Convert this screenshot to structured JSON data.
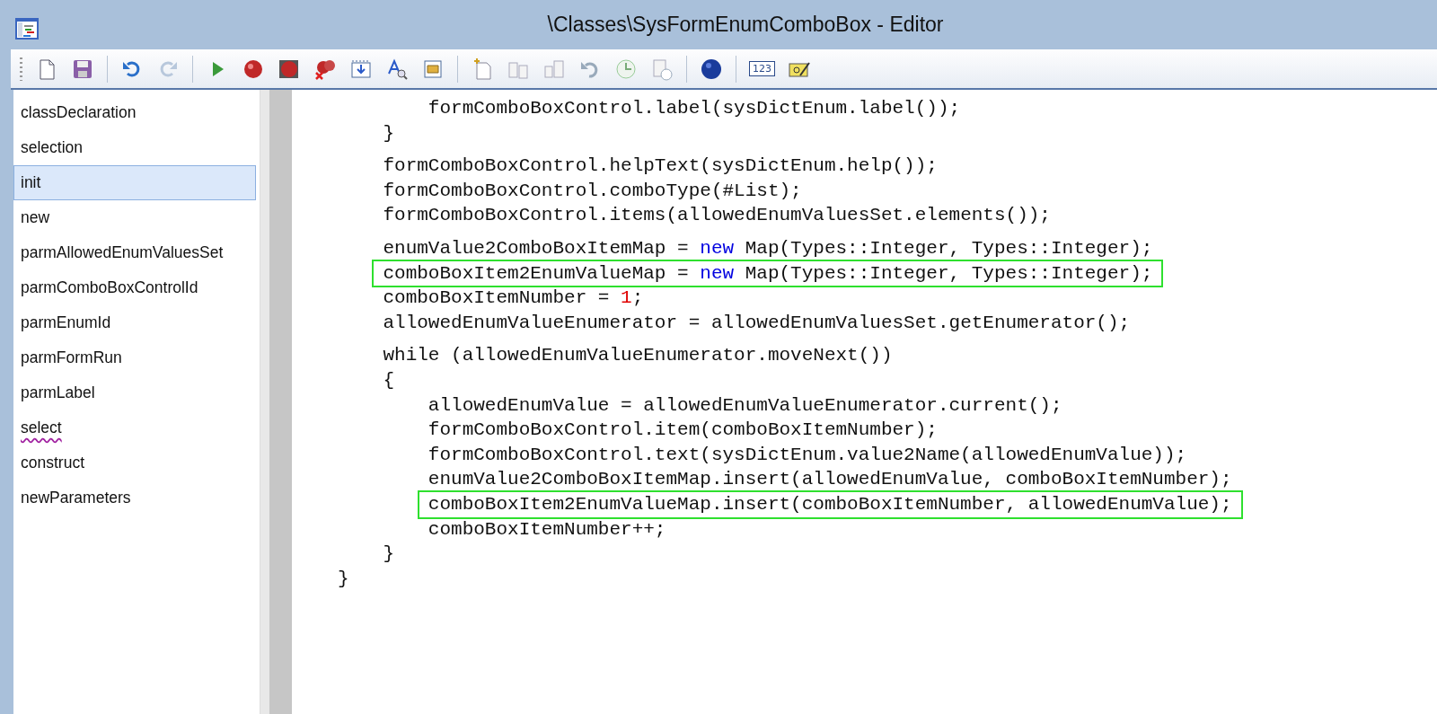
{
  "window": {
    "title": "\\Classes\\SysFormEnumComboBox - Editor"
  },
  "methods": [
    {
      "label": "classDeclaration",
      "selected": false,
      "flagged": false
    },
    {
      "label": "selection",
      "selected": false,
      "flagged": false
    },
    {
      "label": "init",
      "selected": true,
      "flagged": false
    },
    {
      "label": "new",
      "selected": false,
      "flagged": false
    },
    {
      "label": "parmAllowedEnumValuesSet",
      "selected": false,
      "flagged": false
    },
    {
      "label": "parmComboBoxControlId",
      "selected": false,
      "flagged": false
    },
    {
      "label": "parmEnumId",
      "selected": false,
      "flagged": false
    },
    {
      "label": "parmFormRun",
      "selected": false,
      "flagged": false
    },
    {
      "label": "parmLabel",
      "selected": false,
      "flagged": false
    },
    {
      "label": "select",
      "selected": false,
      "flagged": true
    },
    {
      "label": "construct",
      "selected": false,
      "flagged": false
    },
    {
      "label": "newParameters",
      "selected": false,
      "flagged": false
    }
  ],
  "code_blocks": [
    {
      "lines": [
        {
          "boxed": false,
          "segments": [
            {
              "kind": "plain",
              "text": "        formComboBoxControl.label(sysDictEnum.label());"
            }
          ]
        },
        {
          "boxed": false,
          "segments": [
            {
              "kind": "plain",
              "text": "    }"
            }
          ]
        }
      ]
    },
    {
      "lines": [
        {
          "boxed": false,
          "segments": [
            {
              "kind": "plain",
              "text": "    formComboBoxControl.helpText(sysDictEnum.help());"
            }
          ]
        },
        {
          "boxed": false,
          "segments": [
            {
              "kind": "plain",
              "text": "    formComboBoxControl.comboType(#List);"
            }
          ]
        },
        {
          "boxed": false,
          "segments": [
            {
              "kind": "plain",
              "text": "    formComboBoxControl.items(allowedEnumValuesSet.elements());"
            }
          ]
        }
      ]
    },
    {
      "lines": [
        {
          "boxed": false,
          "segments": [
            {
              "kind": "plain",
              "text": "    enumValue2ComboBoxItemMap = "
            },
            {
              "kind": "keyword",
              "text": "new"
            },
            {
              "kind": "plain",
              "text": " Map(Types::Integer, Types::Integer);"
            }
          ]
        },
        {
          "boxed": true,
          "segments": [
            {
              "kind": "plain",
              "text": "    comboBoxItem2EnumValueMap = "
            },
            {
              "kind": "keyword",
              "text": "new"
            },
            {
              "kind": "plain",
              "text": " Map(Types::Integer, Types::Integer);"
            }
          ]
        },
        {
          "boxed": false,
          "segments": [
            {
              "kind": "plain",
              "text": "    comboBoxItemNumber = "
            },
            {
              "kind": "number",
              "text": "1"
            },
            {
              "kind": "plain",
              "text": ";"
            }
          ]
        },
        {
          "boxed": false,
          "segments": [
            {
              "kind": "plain",
              "text": "    allowedEnumValueEnumerator = allowedEnumValuesSet.getEnumerator();"
            }
          ]
        }
      ]
    },
    {
      "lines": [
        {
          "boxed": false,
          "segments": [
            {
              "kind": "plain",
              "text": "    while (allowedEnumValueEnumerator.moveNext())"
            }
          ]
        },
        {
          "boxed": false,
          "segments": [
            {
              "kind": "plain",
              "text": "    {"
            }
          ]
        },
        {
          "boxed": false,
          "segments": [
            {
              "kind": "plain",
              "text": "        allowedEnumValue = allowedEnumValueEnumerator.current();"
            }
          ]
        },
        {
          "boxed": false,
          "segments": [
            {
              "kind": "plain",
              "text": "        formComboBoxControl.item(comboBoxItemNumber);"
            }
          ]
        },
        {
          "boxed": false,
          "segments": [
            {
              "kind": "plain",
              "text": "        formComboBoxControl.text(sysDictEnum.value2Name(allowedEnumValue));"
            }
          ]
        },
        {
          "boxed": false,
          "segments": [
            {
              "kind": "plain",
              "text": "        enumValue2ComboBoxItemMap.insert(allowedEnumValue, comboBoxItemNumber);"
            }
          ]
        },
        {
          "boxed": true,
          "segments": [
            {
              "kind": "plain",
              "text": "        comboBoxItem2EnumValueMap.insert(comboBoxItemNumber, allowedEnumValue);"
            }
          ]
        },
        {
          "boxed": false,
          "segments": [
            {
              "kind": "plain",
              "text": "        comboBoxItemNumber++;"
            }
          ]
        },
        {
          "boxed": false,
          "segments": [
            {
              "kind": "plain",
              "text": "    }"
            }
          ]
        },
        {
          "boxed": false,
          "segments": [
            {
              "kind": "plain",
              "text": "}"
            }
          ]
        }
      ]
    }
  ],
  "toolbar": {
    "icon_label": "123"
  }
}
